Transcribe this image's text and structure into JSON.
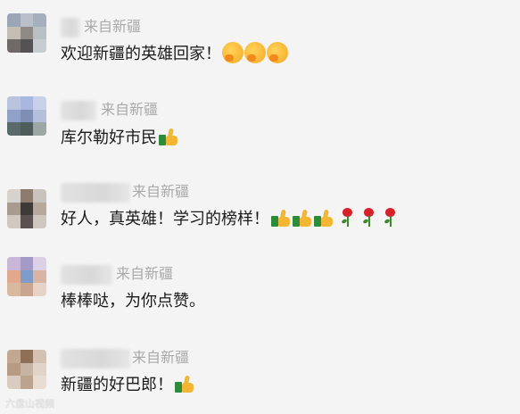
{
  "comments": [
    {
      "region": "来自新疆",
      "text": "欢迎新疆的英雄回家！",
      "emoji": [
        "hug-emoji",
        "hug-emoji",
        "hug-emoji"
      ],
      "avatar_colors": [
        "#9aa5b5",
        "#b8bfc9",
        "#a6b0bd",
        "#c4bdb3",
        "#8f8a86",
        "#b9c0c4",
        "#6f6a68",
        "#555256",
        "#c7ccd0"
      ]
    },
    {
      "region": "来自新疆",
      "text": "库尔勒好市民",
      "emoji": [
        "thumbs-up-emoji"
      ],
      "avatar_colors": [
        "#b9c3de",
        "#a9b7e0",
        "#c9d1ea",
        "#8fa0c9",
        "#7f8eb5",
        "#b6bfd9",
        "#5a6a6a",
        "#4e5d5b",
        "#9aa7a4"
      ]
    },
    {
      "region": "来自新疆",
      "text": "好人，真英雄！学习的榜样！",
      "emoji": [
        "thumbs-up-emoji",
        "thumbs-up-emoji",
        "thumbs-up-emoji",
        "rose-emoji",
        "rose-emoji",
        "rose-emoji"
      ],
      "avatar_colors": [
        "#d7d2cc",
        "#8f7b6e",
        "#c9c3bd",
        "#a79b90",
        "#3e3a3a",
        "#b7a89c",
        "#d0c8c0",
        "#5b5150",
        "#cfc6bd"
      ]
    },
    {
      "region": "来自新疆",
      "text": "棒棒哒，为你点赞。",
      "emoji": [],
      "avatar_colors": [
        "#c9b6d8",
        "#a49ac8",
        "#dcd0e6",
        "#e0a98e",
        "#7f9bc9",
        "#d8b4a4",
        "#d9b8a0",
        "#c9a58f",
        "#e6d2c6"
      ]
    },
    {
      "region": "来自新疆",
      "text": "新疆的好巴郎！",
      "emoji": [
        "thumbs-up-emoji"
      ],
      "avatar_colors": [
        "#c3a891",
        "#8e6f58",
        "#d4c1b1",
        "#b89b83",
        "#c7b3a4",
        "#e0d4c9",
        "#d9cbbd",
        "#bca38e",
        "#e8ddd3"
      ]
    }
  ],
  "watermark": "六盘山视频"
}
